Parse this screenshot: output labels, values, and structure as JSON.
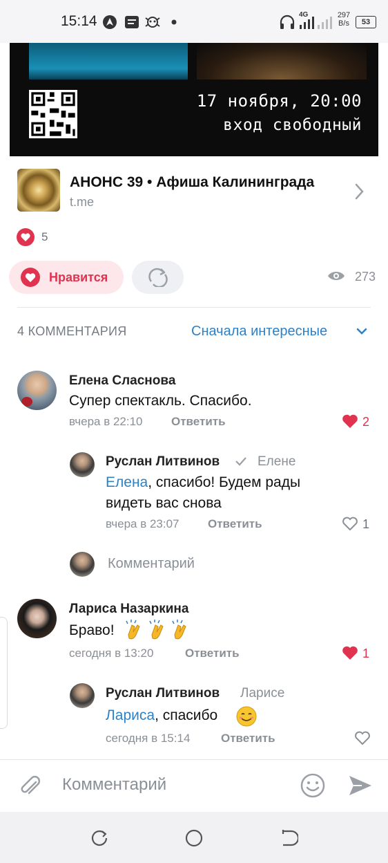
{
  "status_bar": {
    "time": "15:14",
    "network_label": "4G",
    "speed_value": "297",
    "speed_unit": "B/s",
    "battery": "53"
  },
  "banner": {
    "date_text": "17 ноября, 20:00",
    "entry_text": "вход свободный"
  },
  "link_card": {
    "title": "АНОНС 39 • Афиша Калининграда",
    "subtitle": "t.me"
  },
  "post_stats": {
    "reactions_count": "5",
    "views_count": "273"
  },
  "actions": {
    "like_label": "Нравится"
  },
  "comments_header": {
    "count_label": "4 КОММЕНТАРИЯ",
    "sort_label": "Сначала интересные"
  },
  "comments": [
    {
      "author": "Елена Сласнова",
      "text": "Супер спектакль. Спасибо.",
      "time": "вчера в 22:10",
      "reply_label": "Ответить",
      "likes": "2",
      "replies": [
        {
          "author": "Руслан Литвинов",
          "to": "Елене",
          "mention": "Елена",
          "text_line1": ", спасибо! Будем рады",
          "text_line2": "видеть вас снова",
          "time": "вчера в 23:07",
          "reply_label": "Ответить",
          "likes": "1"
        }
      ],
      "reply_input_placeholder": "Комментарий"
    },
    {
      "author": "Лариса Назаркина",
      "text": "Браво!",
      "time": "сегодня в 13:20",
      "reply_label": "Ответить",
      "likes": "1",
      "replies": [
        {
          "author": "Руслан Литвинов",
          "to": "Ларисе",
          "mention": "Лариса",
          "text": ", спасибо",
          "time": "сегодня в 15:14",
          "reply_label": "Ответить"
        }
      ]
    }
  ],
  "composer": {
    "placeholder": "Комментарий"
  },
  "colors": {
    "accent_blue": "#2d81c6",
    "like_red": "#e0334f",
    "like_bg": "#fde7ea"
  }
}
